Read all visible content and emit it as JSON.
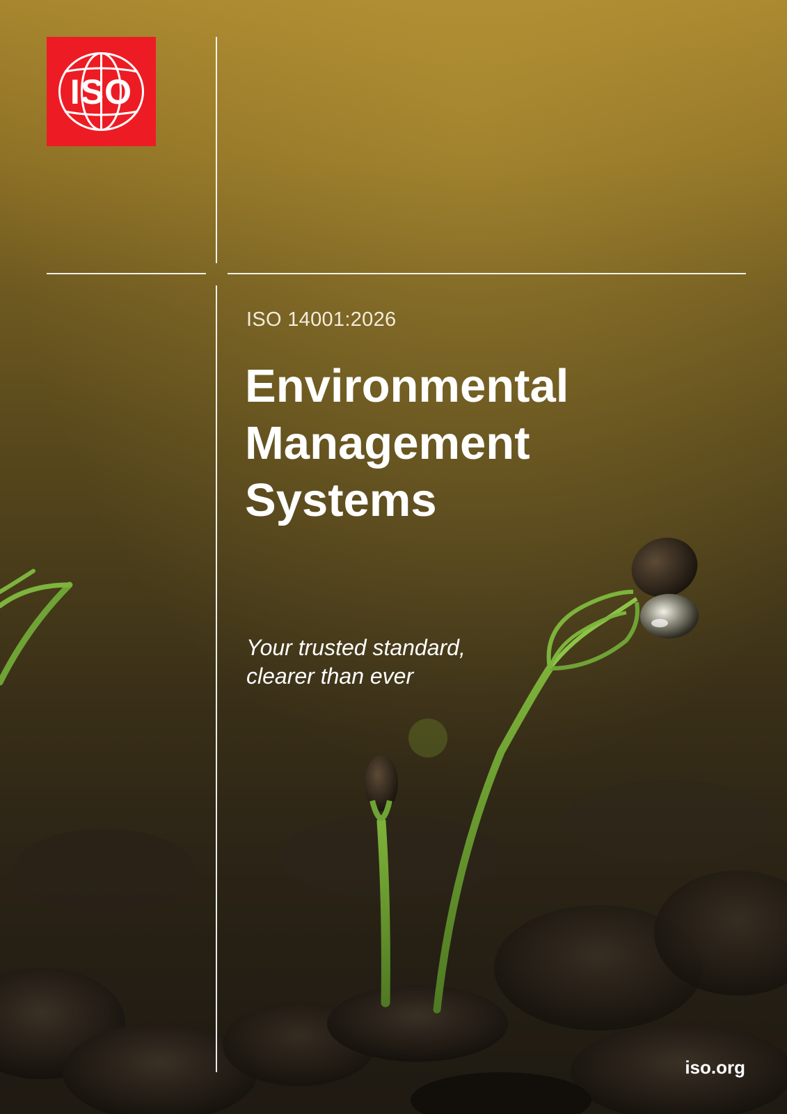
{
  "logo": {
    "text": "ISO",
    "color": "#ed1c24"
  },
  "document": {
    "number": "ISO 14001:2026",
    "title_lines": [
      "Environmental",
      "Management",
      "Systems"
    ],
    "tagline_lines": [
      "Your trusted standard,",
      "clearer than ever"
    ]
  },
  "footer": {
    "site": "iso.org"
  },
  "colors": {
    "background_top": "#a8862f",
    "background_bottom": "#1f1a12",
    "text": "#ffffff"
  }
}
